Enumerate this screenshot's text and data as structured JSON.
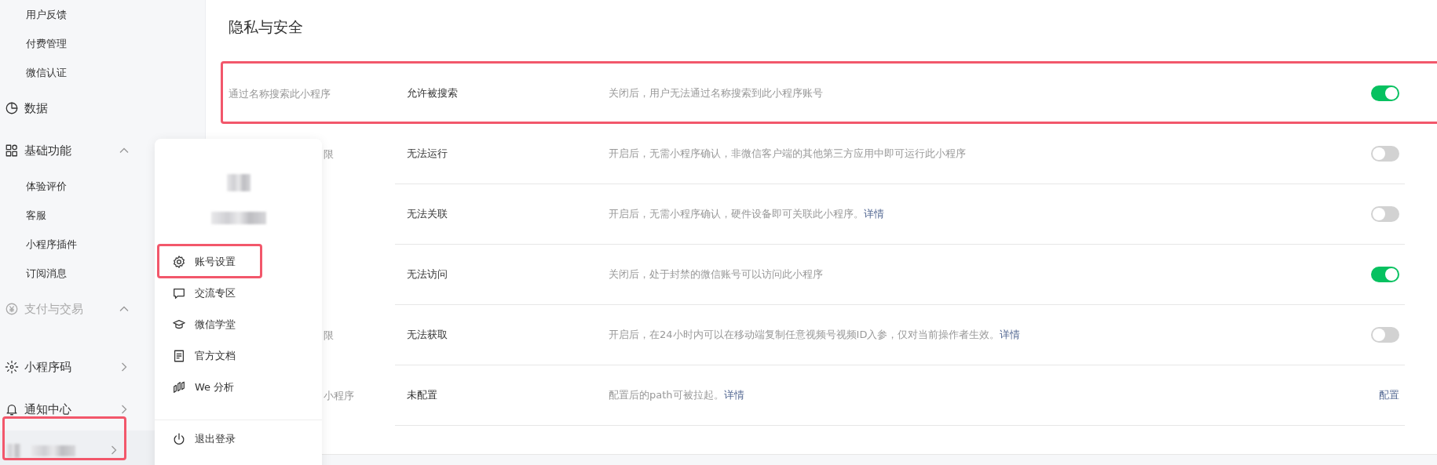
{
  "sidebar": {
    "items": [
      {
        "kind": "sub",
        "label": "用户反馈"
      },
      {
        "kind": "sub",
        "label": "付费管理"
      },
      {
        "kind": "sub",
        "label": "微信认证"
      },
      {
        "kind": "link",
        "label": "数据",
        "disabled": false
      },
      {
        "kind": "group",
        "label": "基础功能",
        "expanded": true,
        "disabled": false
      },
      {
        "kind": "sub",
        "label": "体验评价"
      },
      {
        "kind": "sub",
        "label": "客服"
      },
      {
        "kind": "sub",
        "label": "小程序插件"
      },
      {
        "kind": "sub",
        "label": "订阅消息"
      },
      {
        "kind": "group",
        "label": "支付与交易",
        "expanded": true,
        "disabled": true
      },
      {
        "kind": "gap"
      },
      {
        "kind": "group",
        "label": "小程序码",
        "expanded": false,
        "disabled": false
      },
      {
        "kind": "group",
        "label": "通知中心",
        "expanded": false,
        "disabled": false
      }
    ],
    "account": {
      "highlighted": true
    }
  },
  "page": {
    "title": "隐私与安全",
    "rows": [
      {
        "label": "通过名称搜索此小程序",
        "covered": false,
        "value": "允许被搜索",
        "desc": "关闭后，用户无法通过名称搜索到此小程序账号",
        "kind": "toggle",
        "on": true,
        "highlighted": true
      },
      {
        "label": "限",
        "covered": true,
        "value": "无法运行",
        "desc": "开启后，无需小程序确认，非微信客户端的其他第三方应用中即可运行此小程序",
        "kind": "toggle",
        "on": false,
        "highlighted": false
      },
      {
        "value": "无法关联",
        "desc": "开启后，无需小程序确认，硬件设备即可关联此小程序。",
        "link": "详情",
        "kind": "toggle",
        "on": false,
        "highlighted": false
      },
      {
        "value": "无法访问",
        "desc": "关闭后，处于封禁的微信账号可以访问此小程序",
        "kind": "toggle",
        "on": true,
        "highlighted": false
      },
      {
        "label": "限",
        "covered": true,
        "value": "无法获取",
        "desc": "开启后，在24小时内可以在移动端复制任意视频号视频ID入参，仅对当前操作者生效。",
        "link": "详情",
        "kind": "toggle",
        "on": false,
        "highlighted": false
      },
      {
        "label": "小程序",
        "covered": true,
        "value": "未配置",
        "desc": "配置后的path可被拉起。",
        "link": "详情",
        "kind": "action",
        "action": "配置",
        "highlighted": false
      }
    ]
  },
  "popup": {
    "menu": [
      {
        "label": "账号设置",
        "highlighted": true
      },
      {
        "label": "交流专区",
        "highlighted": false
      },
      {
        "label": "微信学堂",
        "highlighted": false
      },
      {
        "label": "官方文档",
        "highlighted": false
      },
      {
        "label": "We 分析",
        "highlighted": false
      }
    ],
    "logout": "退出登录"
  }
}
